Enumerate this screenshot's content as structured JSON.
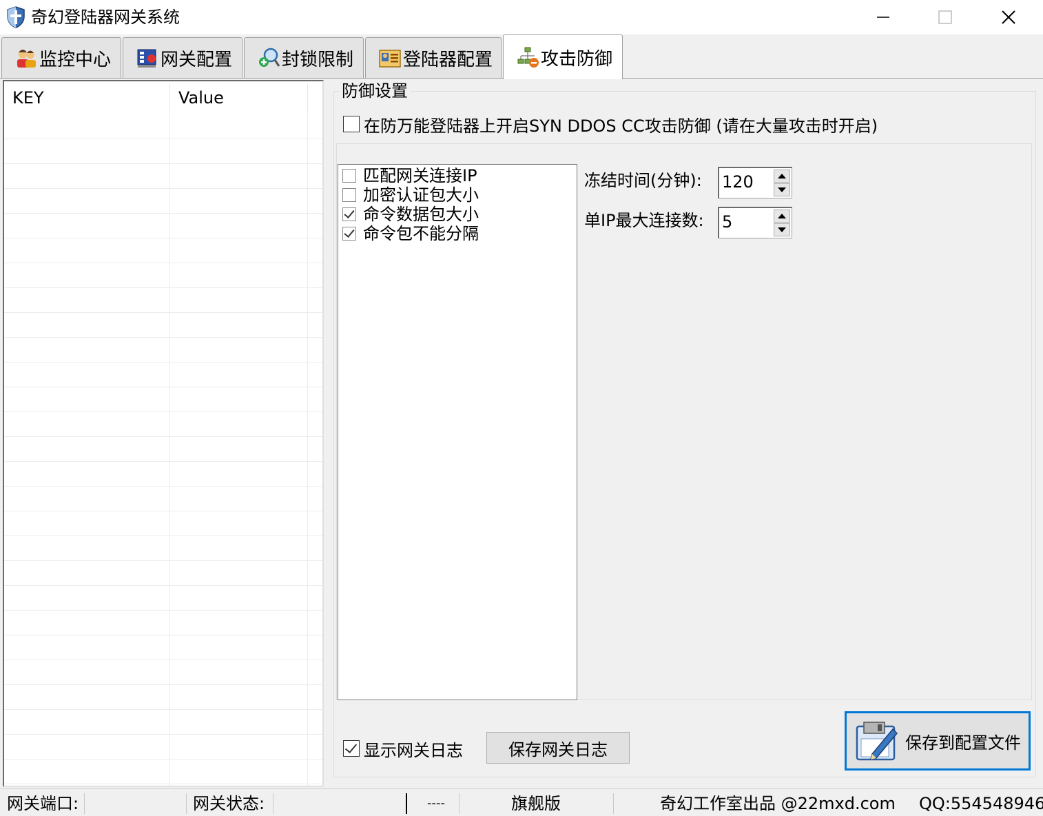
{
  "window": {
    "title": "奇幻登陆器网关系统",
    "icon": "shield-icon",
    "controls": [
      "minimize-icon",
      "maximize-icon",
      "close-icon"
    ]
  },
  "tabs": [
    {
      "label": "监控中心",
      "icon": "users-icon",
      "active": false
    },
    {
      "label": "网关配置",
      "icon": "gateway-config-icon",
      "active": false
    },
    {
      "label": "封锁限制",
      "icon": "block-search-icon",
      "active": false
    },
    {
      "label": "登陆器配置",
      "icon": "id-card-icon",
      "active": false
    },
    {
      "label": "攻击防御",
      "icon": "network-defense-icon",
      "active": true
    }
  ],
  "kv_table": {
    "columns": [
      "KEY",
      "Value"
    ],
    "rows": []
  },
  "defense": {
    "group_title": "防御设置",
    "syn_ddos_label": "在防万能登陆器上开启SYN DDOS CC攻击防御 (请在大量攻击时开启)",
    "syn_ddos_checked": false,
    "checklist": [
      {
        "label": "匹配网关连接IP",
        "checked": false
      },
      {
        "label": "加密认证包大小",
        "checked": false
      },
      {
        "label": "命令数据包大小",
        "checked": true
      },
      {
        "label": "命令包不能分隔",
        "checked": true
      }
    ],
    "freeze_label": "冻结时间(分钟):",
    "freeze_value": "120",
    "max_conn_label": "单IP最大连接数:",
    "max_conn_value": "5",
    "show_log_label": "显示网关日志",
    "show_log_checked": true,
    "save_log_label": "保存网关日志",
    "save_config_label": "保存到配置文件"
  },
  "statusbar": {
    "port_label": "网关端口:",
    "port_value": "",
    "state_label": "网关状态:",
    "state_value": "",
    "dash": "----",
    "edition": "旗舰版",
    "credit": "奇幻工作室出品 @22mxd.com",
    "qq": "QQ:554548946"
  },
  "colors": {
    "background": "#f0f0f0",
    "focus_border": "#0078d7"
  }
}
